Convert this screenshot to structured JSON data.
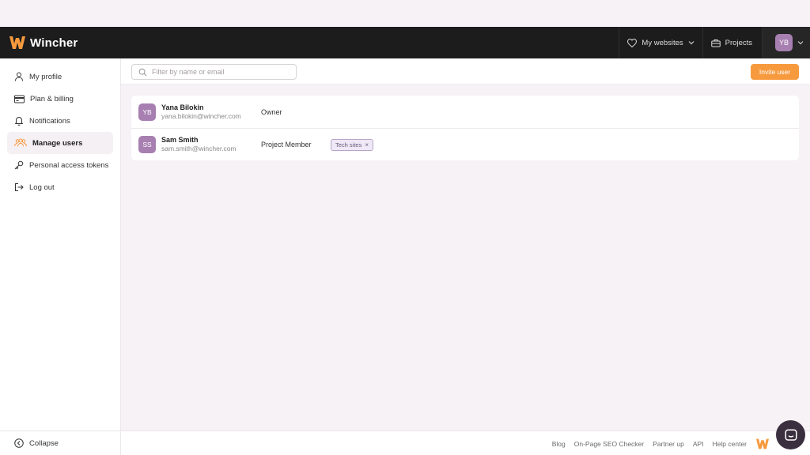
{
  "brand": {
    "name": "Wincher",
    "accent": "#f79a3e"
  },
  "header": {
    "my_websites": "My websites",
    "projects": "Projects",
    "user_initials": "YB"
  },
  "sidebar": {
    "items": [
      {
        "label": "My profile",
        "icon": "user-icon"
      },
      {
        "label": "Plan & billing",
        "icon": "credit-card-icon"
      },
      {
        "label": "Notifications",
        "icon": "bell-icon"
      },
      {
        "label": "Manage users",
        "icon": "users-icon",
        "active": true
      },
      {
        "label": "Personal access tokens",
        "icon": "key-icon"
      },
      {
        "label": "Log out",
        "icon": "logout-icon"
      }
    ],
    "collapse_label": "Collapse"
  },
  "toolbar": {
    "search_placeholder": "Filter by name or email",
    "invite_label": "Invite user"
  },
  "users": [
    {
      "initials": "YB",
      "name": "Yana Bilokin",
      "email": "yana.bilokin@wincher.com",
      "role": "Owner",
      "tags": []
    },
    {
      "initials": "SS",
      "name": "Sam Smith",
      "email": "sam.smith@wincher.com",
      "role": "Project Member",
      "tags": [
        "Tech sites"
      ]
    }
  ],
  "footer": {
    "links": [
      "Blog",
      "On-Page SEO Checker",
      "Partner up",
      "API",
      "Help center"
    ]
  }
}
